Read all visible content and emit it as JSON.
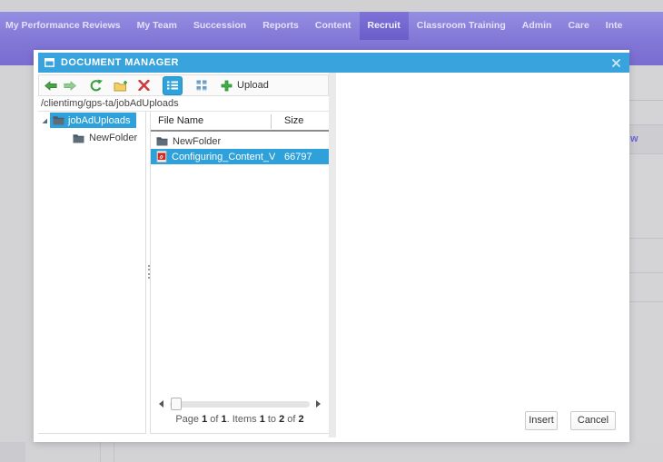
{
  "topnav": {
    "items": [
      {
        "label": "My Performance Reviews"
      },
      {
        "label": "My Team"
      },
      {
        "label": "Succession"
      },
      {
        "label": "Reports"
      },
      {
        "label": "Content"
      },
      {
        "label": "Recruit",
        "active": true
      },
      {
        "label": "Classroom Training"
      },
      {
        "label": "Admin"
      },
      {
        "label": "Care"
      },
      {
        "label": "Inte"
      }
    ]
  },
  "background": {
    "partial_link_text": "w"
  },
  "dialog": {
    "title": "DOCUMENT MANAGER",
    "toolbar": {
      "upload_label": "Upload"
    },
    "address": "/clientimg/gps-ta/jobAdUploads",
    "tree": {
      "root": {
        "label": "jobAdUploads",
        "selected": true
      },
      "child": {
        "label": "NewFolder"
      }
    },
    "files": {
      "columns": [
        "File Name",
        "Size"
      ],
      "rows": [
        {
          "name": "NewFolder",
          "size": "",
          "type": "folder",
          "selected": false
        },
        {
          "name": "Configuring_Content_Vendo",
          "size": "66797",
          "type": "pdf",
          "selected": true
        }
      ],
      "pager_parts": [
        "Page ",
        "1",
        " of ",
        "1",
        ". Items ",
        "1",
        " to ",
        "2",
        " of ",
        "2"
      ]
    },
    "buttons": {
      "insert": "Insert",
      "cancel": "Cancel"
    }
  },
  "colors": {
    "titlebar_blue": "#38a3dc",
    "selection_blue": "#2ea0da",
    "nav_purple": "#837ad6",
    "nav_active_purple": "#6b5dca",
    "toolbar_green": "#3ba03f",
    "delete_red": "#d23b3b",
    "folder_yellow": "#f3cf66",
    "pdf_red": "#cf2a20",
    "page_bg": "#d3d3d5"
  }
}
